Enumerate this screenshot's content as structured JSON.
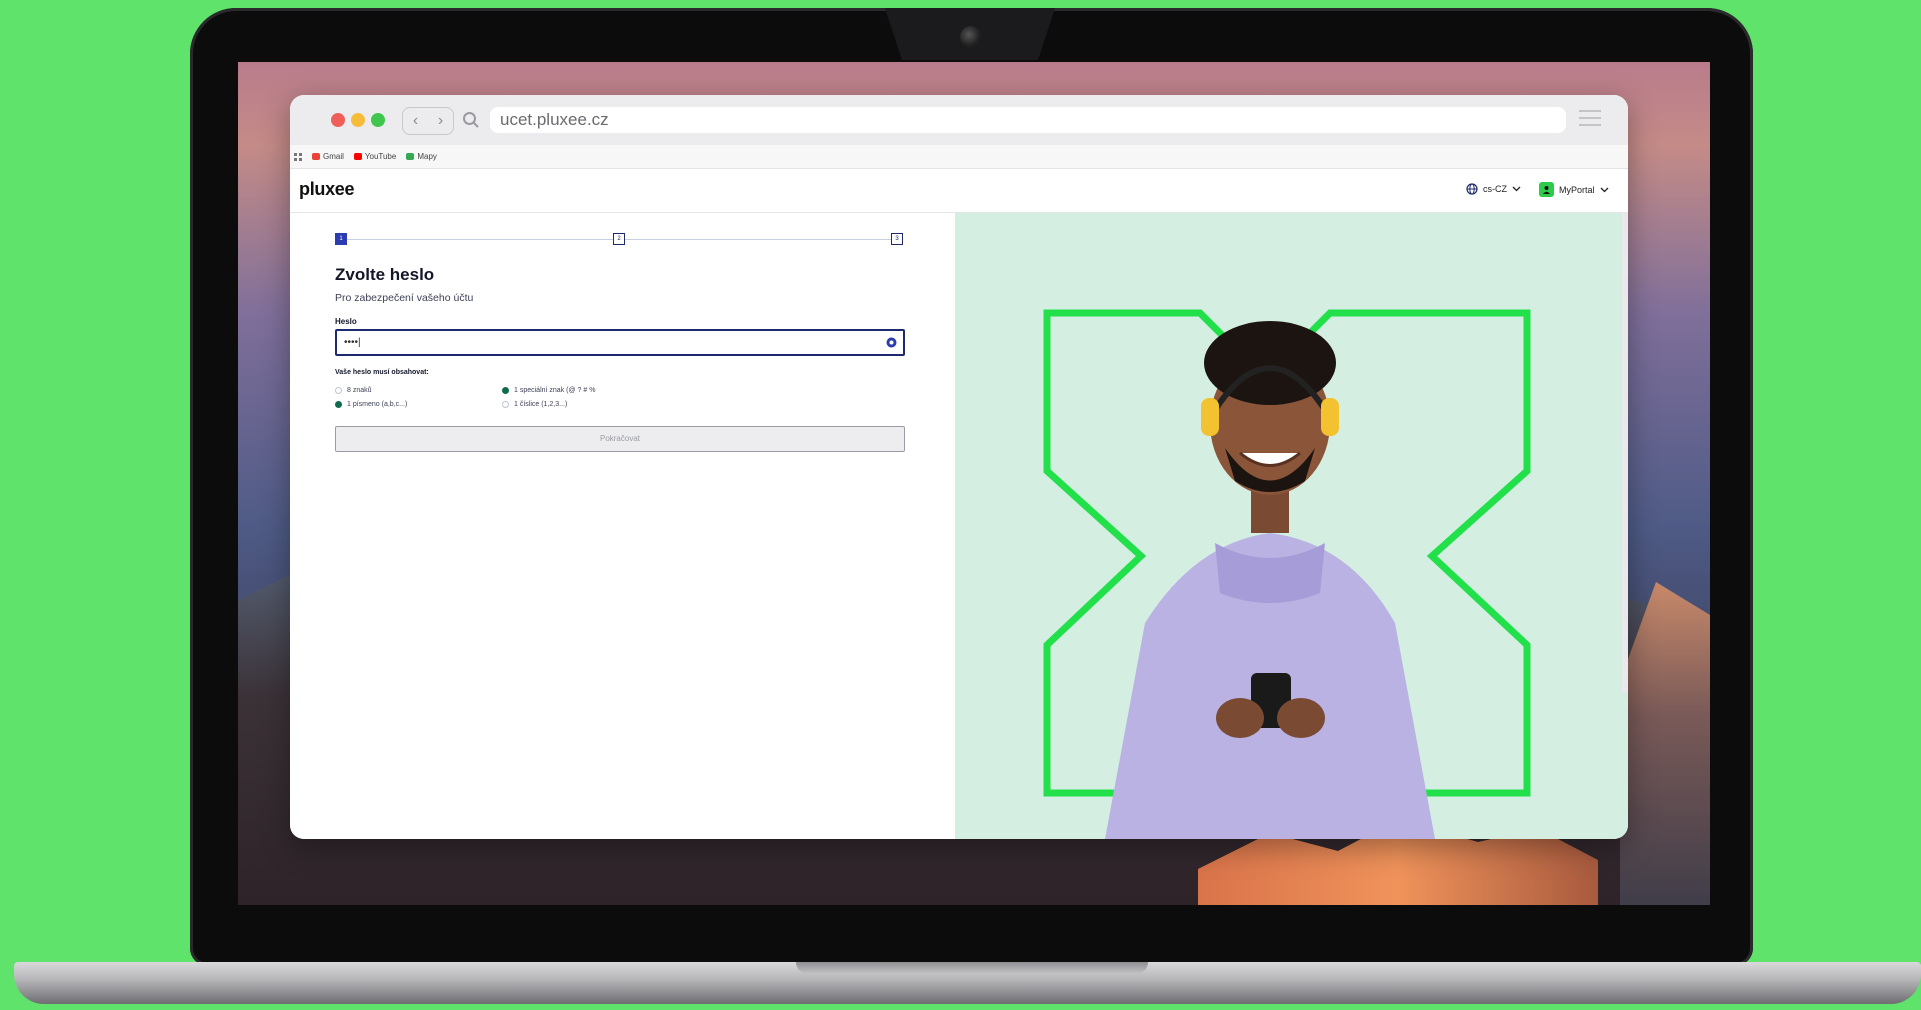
{
  "browser": {
    "url": "ucet.pluxee.cz",
    "bookmarks": [
      {
        "label": "Gmail",
        "color": "#ea4335"
      },
      {
        "label": "YouTube",
        "color": "#ff0000"
      },
      {
        "label": "Mapy",
        "color": "#34a853"
      }
    ]
  },
  "header": {
    "logo": "pluxee",
    "language": "cs-CZ",
    "portal": "MyPortal"
  },
  "form": {
    "steps": [
      "1",
      "2",
      "3"
    ],
    "active_step": 1,
    "title": "Zvolte heslo",
    "subtitle": "Pro zabezpečení vašeho účtu",
    "password_label": "Heslo",
    "password_value": "••••|",
    "requirements_title": "Vaše heslo musí obsahovat:",
    "requirements": [
      {
        "label": "8 znaků",
        "met": false
      },
      {
        "label": "1 speciální znak (@ ? # %",
        "met": true
      },
      {
        "label": "1 písmeno (a,b,c...)",
        "met": true
      },
      {
        "label": "1 číslice (1,2,3...)",
        "met": false
      }
    ],
    "continue_label": "Pokračovat"
  },
  "colors": {
    "page_bg": "#5fe36a",
    "brand_navy": "#1e2a6e",
    "brand_green": "#21e04a",
    "hero_bg": "#d4efe2",
    "check_green": "#0f6b4e"
  }
}
